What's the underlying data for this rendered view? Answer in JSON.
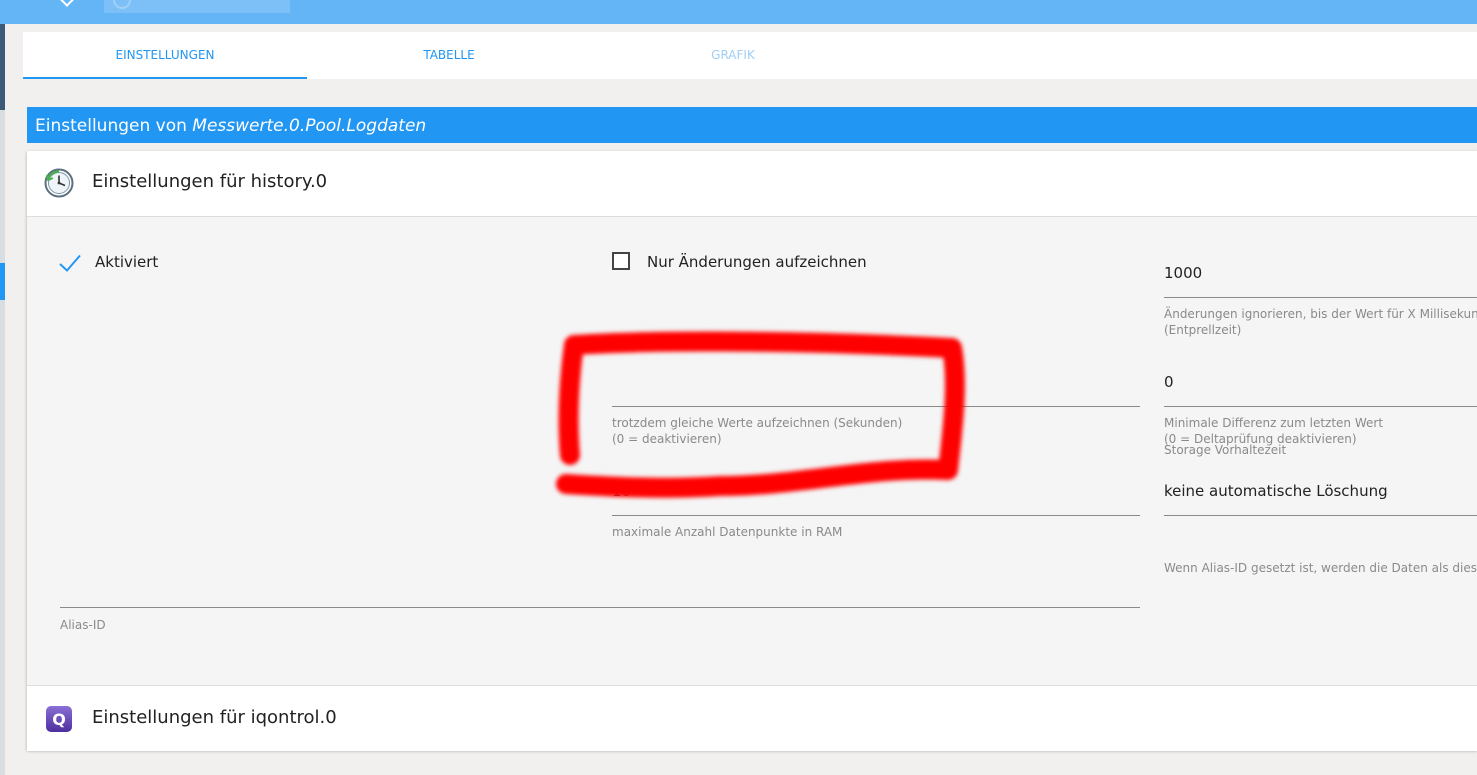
{
  "tabs": [
    {
      "label": "EINSTELLUNGEN",
      "active": true
    },
    {
      "label": "TABELLE",
      "active": false
    },
    {
      "label": "GRAFIK",
      "active": false,
      "disabled": true
    }
  ],
  "header": {
    "prefix": "Einstellungen von",
    "object_id": "Messwerte.0.Pool.Logdaten"
  },
  "sections": {
    "history": {
      "title": "Einstellungen für history.0",
      "icon": "clock-icon",
      "enabled_label": "Aktiviert",
      "changes_only_label": "Nur Änderungen aufzeichnen",
      "changes_only_checked": false,
      "debounce": {
        "value": "1000",
        "help1": "Änderungen ignorieren, bis der Wert für X Millisekunden",
        "help2": "(Entprellzeit)"
      },
      "record_same": {
        "value": "",
        "help1": "trotzdem gleiche Werte aufzeichnen (Sekunden)",
        "help2": "(0 = deaktivieren)"
      },
      "min_diff": {
        "value": "0",
        "help1": "Minimale Differenz zum letzten Wert",
        "help2": "(0 = Deltaprüfung deaktivieren)"
      },
      "max_points": {
        "value": "10",
        "help": "maximale Anzahl Datenpunkte in RAM"
      },
      "retention": {
        "label": "Storage Vorhaltezeit",
        "value": "keine automatische Löschung"
      },
      "alias": {
        "value": "",
        "label": "Alias-ID",
        "help": "Wenn Alias-ID gesetzt ist, werden die Daten als diese"
      }
    },
    "iqontrol": {
      "title": "Einstellungen für iqontrol.0",
      "icon": "iqontrol-icon",
      "icon_letter": "Q"
    }
  },
  "colors": {
    "accent": "#2196f3",
    "topbar": "#64b5f6",
    "annotation": "#ff0000"
  }
}
